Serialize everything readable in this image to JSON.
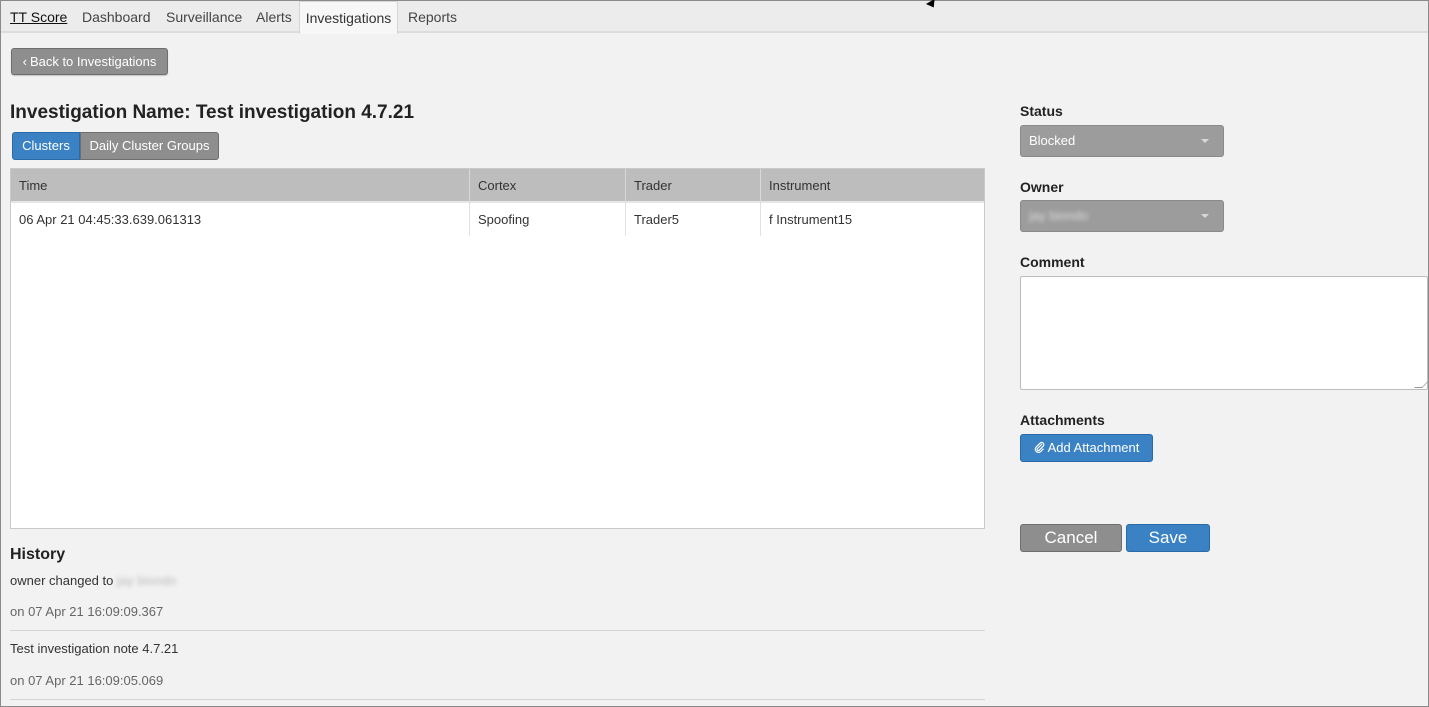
{
  "nav": {
    "brand": "TT Score",
    "items": [
      "Dashboard",
      "Surveillance",
      "Alerts",
      "Investigations",
      "Reports"
    ],
    "active": "Investigations"
  },
  "back_button": {
    "icon": "chevron-left-icon",
    "label": "Back to Investigations"
  },
  "investigation": {
    "title": "Investigation Name: Test investigation 4.7.21"
  },
  "segments": {
    "clusters": "Clusters",
    "daily": "Daily Cluster Groups",
    "active": "Clusters"
  },
  "table": {
    "columns": [
      "Time",
      "Cortex",
      "Trader",
      "Instrument"
    ],
    "rows": [
      [
        "06 Apr 21 04:45:33.639.061313",
        "Spoofing",
        "Trader5",
        "f Instrument15"
      ]
    ]
  },
  "history": {
    "title": "History",
    "entries": [
      {
        "text_prefix": "owner changed to",
        "redacted_value": "jay biondo",
        "meta": "on 07 Apr 21 16:09:09.367"
      },
      {
        "text": "Test investigation note 4.7.21",
        "meta": "on 07 Apr 21 16:09:05.069"
      }
    ]
  },
  "right_panel": {
    "status_label": "Status",
    "status_value": "Blocked",
    "owner_label": "Owner",
    "owner_value": "jay biondo",
    "comment_label": "Comment",
    "comment_value": "",
    "attachments_label": "Attachments",
    "add_attachment": {
      "icon": "paperclip-icon",
      "label": "Add Attachment"
    },
    "cancel_label": "Cancel",
    "save_label": "Save"
  },
  "colors": {
    "primary": "#3a82c4",
    "secondary": "#8e8e8e",
    "header": "#bdbdbd"
  }
}
